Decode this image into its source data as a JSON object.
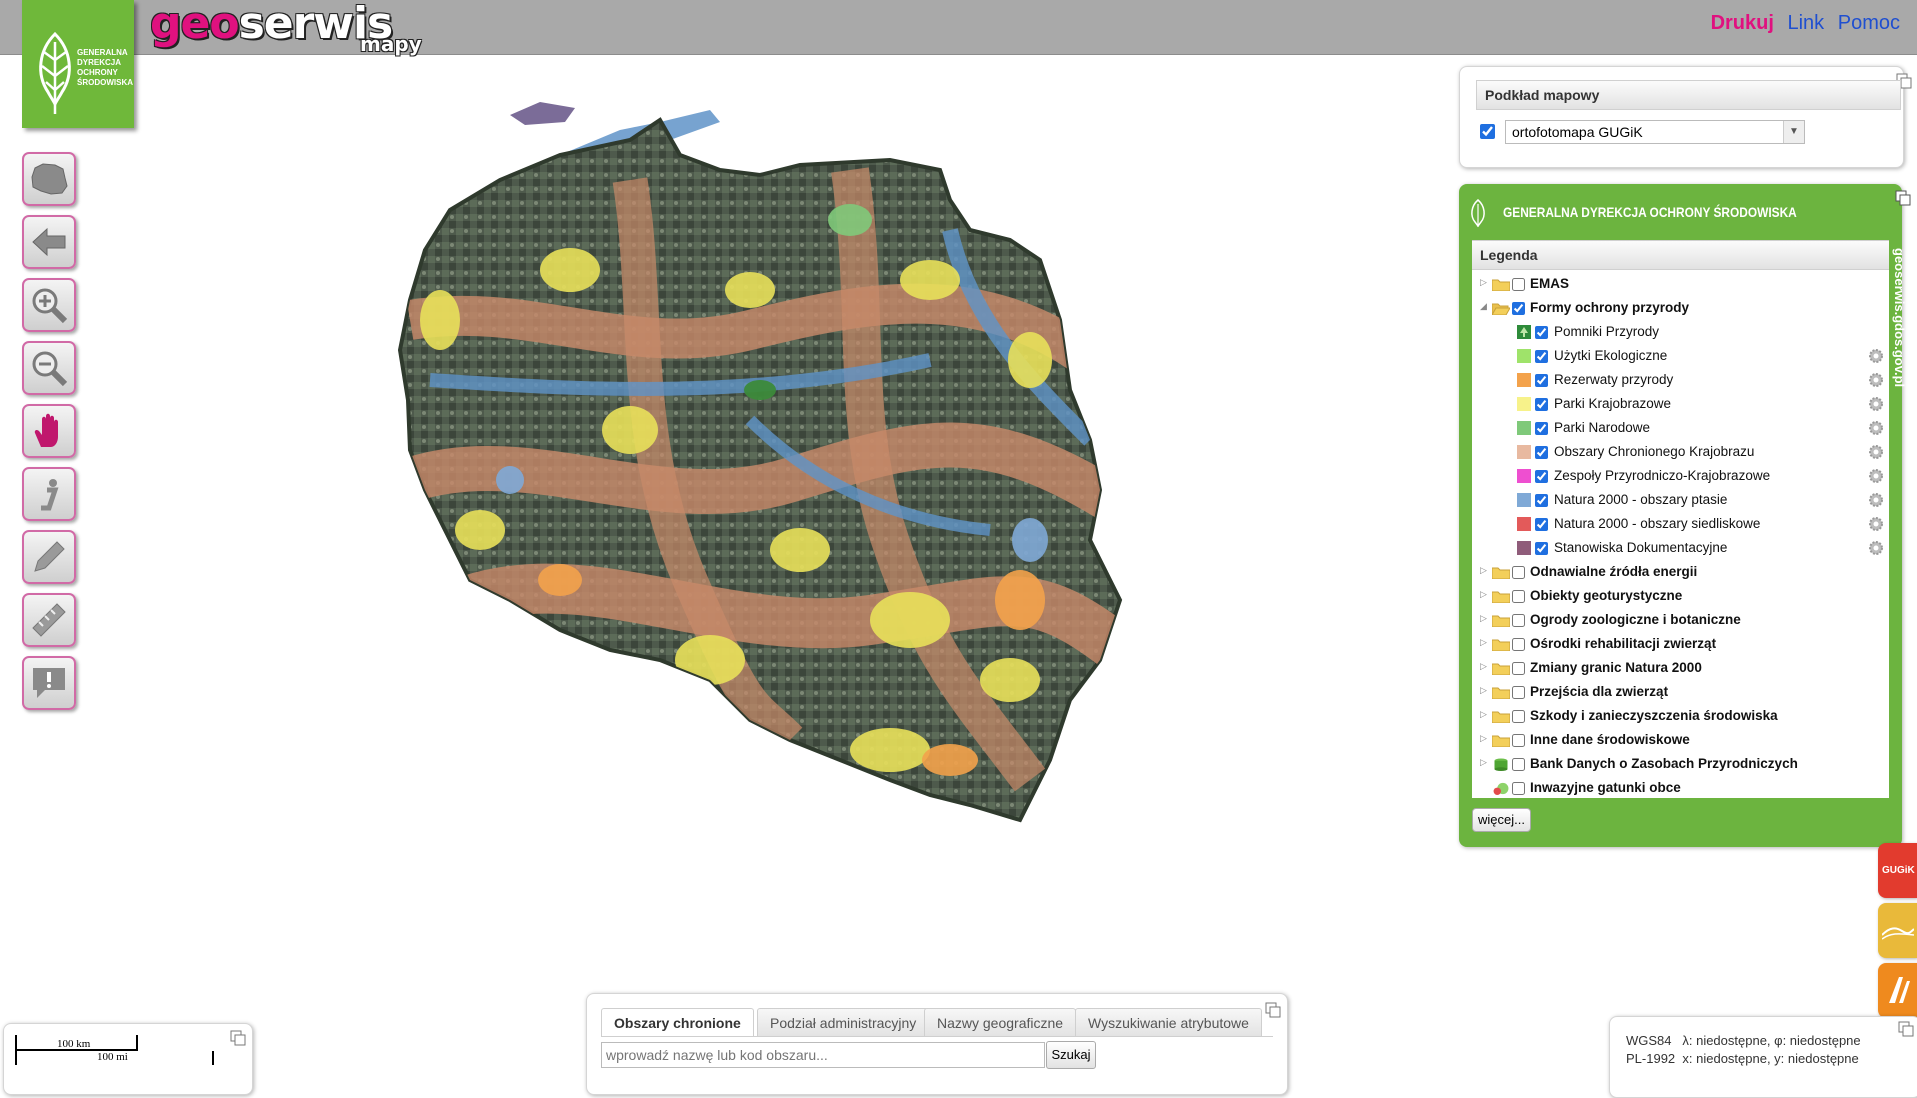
{
  "header": {
    "brand_geo": "geo",
    "brand_rest": "serwis",
    "brand_sub": "mapy",
    "links": {
      "print": "Drukuj",
      "link": "Link",
      "help": "Pomoc"
    },
    "colors": {
      "print": "#e0117f",
      "link": "#1f4fd0",
      "help": "#1f4fd0"
    }
  },
  "logo": {
    "lines": [
      "GENERALNA",
      "DYREKCJA",
      "OCHRONY",
      "ŚRODOWISKA"
    ]
  },
  "toolbar": [
    {
      "name": "full-extent-button",
      "icon": "poland-map-icon"
    },
    {
      "name": "back-button",
      "icon": "arrow-left-icon"
    },
    {
      "name": "zoom-in-button",
      "icon": "zoom-in-icon"
    },
    {
      "name": "zoom-out-button",
      "icon": "zoom-out-icon"
    },
    {
      "name": "pan-button",
      "icon": "hand-icon"
    },
    {
      "name": "info-button",
      "icon": "info-icon"
    },
    {
      "name": "draw-button",
      "icon": "pencil-icon"
    },
    {
      "name": "measure-button",
      "icon": "ruler-icon"
    },
    {
      "name": "report-button",
      "icon": "alert-icon"
    }
  ],
  "basemap": {
    "title": "Podkład mapowy",
    "selected": "ortofotomapa GUGiK",
    "checked": true
  },
  "legend_panel": {
    "org_title": "GENERALNA DYREKCJA OCHRONY ŚRODOWISKA",
    "legend_title": "Legenda",
    "side_text": "geoserwis.gdos.gov.pl",
    "more_button": "więcej...",
    "groups_top": [
      {
        "label": "EMAS",
        "checked": false,
        "expanded": false
      }
    ],
    "group_expanded": {
      "label": "Formy ochrony przyrody",
      "checked": true
    },
    "layers": [
      {
        "label": "Pomniki Przyrody",
        "color": "#2e8b3a",
        "icon": "tree-icon",
        "gear": false
      },
      {
        "label": "Użytki Ekologiczne",
        "color": "#9fe36a",
        "gear": true
      },
      {
        "label": "Rezerwaty przyrody",
        "color": "#f3a24b",
        "gear": true
      },
      {
        "label": "Parki Krajobrazowe",
        "color": "#f7f28a",
        "gear": true
      },
      {
        "label": "Parki Narodowe",
        "color": "#7fc97a",
        "gear": true
      },
      {
        "label": "Obszary Chronionego Krajobrazu",
        "color": "#e8b9a0",
        "gear": true
      },
      {
        "label": "Zespoły Przyrodniczo-Krajobrazowe",
        "color": "#ee4fd0",
        "gear": true
      },
      {
        "label": "Natura 2000 - obszary ptasie",
        "color": "#7fa9d6",
        "gear": true
      },
      {
        "label": "Natura 2000 - obszary siedliskowe",
        "color": "#e35a5a",
        "gear": true
      },
      {
        "label": "Stanowiska Dokumentacyjne",
        "color": "#8f5c7a",
        "gear": true
      }
    ],
    "groups_bottom": [
      {
        "label": "Odnawialne źródła energii",
        "icon": "folder-icon"
      },
      {
        "label": "Obiekty geoturystyczne",
        "icon": "folder-icon"
      },
      {
        "label": "Ogrody zoologiczne i botaniczne",
        "icon": "folder-icon"
      },
      {
        "label": "Ośrodki rehabilitacji zwierząt",
        "icon": "folder-icon"
      },
      {
        "label": "Zmiany granic Natura 2000",
        "icon": "folder-icon"
      },
      {
        "label": "Przejścia dla zwierząt",
        "icon": "folder-icon"
      },
      {
        "label": "Szkody i zanieczyszczenia środowiska",
        "icon": "folder-icon"
      },
      {
        "label": "Inne dane środowiskowe",
        "icon": "folder-icon"
      },
      {
        "label": "Bank Danych o Zasobach Przyrodniczych",
        "icon": "database-icon"
      },
      {
        "label": "Inwazyjne gatunki obce",
        "icon": "invasive-species-icon"
      }
    ]
  },
  "side_tabs": [
    {
      "name": "gugik-tab",
      "label": "GUGiK",
      "color": "#e23b2e"
    },
    {
      "name": "terrain-tab",
      "label": "",
      "color": "#e9b93a"
    },
    {
      "name": "roads-tab",
      "label": "",
      "color": "#ef8a1e"
    }
  ],
  "search": {
    "tabs": [
      "Obszary chronione",
      "Podział administracyjny",
      "Nazwy geograficzne",
      "Wyszukiwanie atrybutowe"
    ],
    "active_tab": 0,
    "placeholder": "wprowadź nazwę lub kod obszaru...",
    "button": "Szukaj"
  },
  "scalebar": {
    "km": "100 km",
    "mi": "100 mi"
  },
  "coords": {
    "line1_sys": "WGS84",
    "line1_val": "λ: niedostępne, φ: niedostępne",
    "line2_sys": "PL-1992",
    "line2_val": "x: niedostępne, y: niedostępne"
  }
}
